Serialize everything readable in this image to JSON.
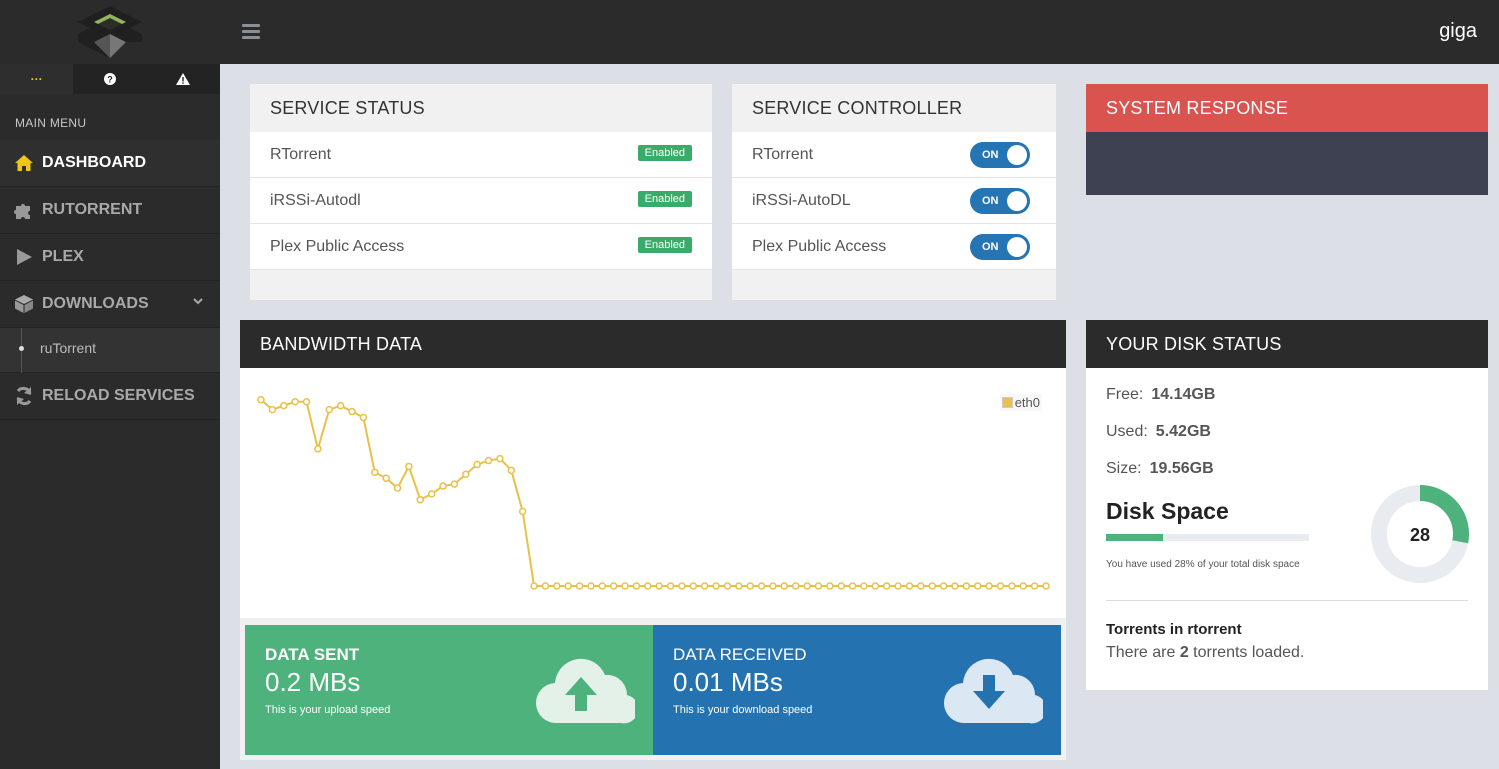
{
  "sidebar": {
    "quick": [
      "···",
      "?",
      "!"
    ],
    "menu_title": "MAIN MENU",
    "items": [
      {
        "label": "DASHBOARD",
        "icon": "home-icon"
      },
      {
        "label": "RUTORRENT",
        "icon": "puzzle-icon"
      },
      {
        "label": "PLEX",
        "icon": "play-icon"
      },
      {
        "label": "DOWNLOADS",
        "icon": "box-icon"
      },
      {
        "label": "RELOAD SERVICES",
        "icon": "refresh-icon"
      }
    ],
    "sub_items": [
      {
        "label": "ruTorrent"
      }
    ]
  },
  "header": {
    "user": "giga"
  },
  "service_status": {
    "title": "SERVICE STATUS",
    "rows": [
      {
        "name": "RTorrent",
        "status": "Enabled"
      },
      {
        "name": "iRSSi-Autodl",
        "status": "Enabled"
      },
      {
        "name": "Plex Public Access",
        "status": "Enabled"
      }
    ]
  },
  "service_controller": {
    "title": "SERVICE CONTROLLER",
    "rows": [
      {
        "name": "RTorrent",
        "state": "ON"
      },
      {
        "name": "iRSSi-AutoDL",
        "state": "ON"
      },
      {
        "name": "Plex Public Access",
        "state": "ON"
      }
    ]
  },
  "system_response": {
    "title": "SYSTEM RESPONSE"
  },
  "bandwidth": {
    "title": "BANDWIDTH DATA",
    "sent": {
      "title": "DATA SENT",
      "value": "0.2 MBs",
      "caption": "This is your upload speed"
    },
    "received": {
      "title": "DATA RECEIVED",
      "value": "0.01 MBs",
      "caption": "This is your download speed"
    }
  },
  "chart_data": {
    "type": "line",
    "series": [
      {
        "name": "eth0",
        "color": "#e8c04a",
        "values": [
          0.95,
          0.9,
          0.92,
          0.94,
          0.94,
          0.7,
          0.9,
          0.92,
          0.89,
          0.86,
          0.58,
          0.55,
          0.5,
          0.61,
          0.44,
          0.47,
          0.51,
          0.52,
          0.57,
          0.62,
          0.64,
          0.65,
          0.59,
          0.38,
          0.0,
          0.0,
          0.0,
          0.0,
          0.0,
          0.0,
          0.0,
          0.0,
          0.0,
          0.0,
          0.0,
          0.0,
          0.0,
          0.0,
          0.0,
          0.0,
          0.0,
          0.0,
          0.0,
          0.0,
          0.0,
          0.0,
          0.0,
          0.0,
          0.0,
          0.0,
          0.0,
          0.0,
          0.0,
          0.0,
          0.0,
          0.0,
          0.0,
          0.0,
          0.0,
          0.0,
          0.0,
          0.0,
          0.0,
          0.0,
          0.0,
          0.0,
          0.0,
          0.0,
          0.0,
          0.0
        ]
      }
    ],
    "ylim": [
      0,
      1
    ],
    "legend": "top-right",
    "grid": false
  },
  "disk": {
    "title": "YOUR DISK STATUS",
    "free_label": "Free:",
    "free": "14.14GB",
    "used_label": "Used:",
    "used": "5.42GB",
    "size_label": "Size:",
    "size": "19.56GB",
    "space_title": "Disk Space",
    "percent": 28,
    "percent_text": "28",
    "note": "You have used 28% of your total disk space",
    "torrents_title": "Torrents in rtorrent",
    "torrents_pre": "There are ",
    "torrents_count": "2",
    "torrents_post": " torrents loaded.",
    "accent": "#4db27b"
  }
}
